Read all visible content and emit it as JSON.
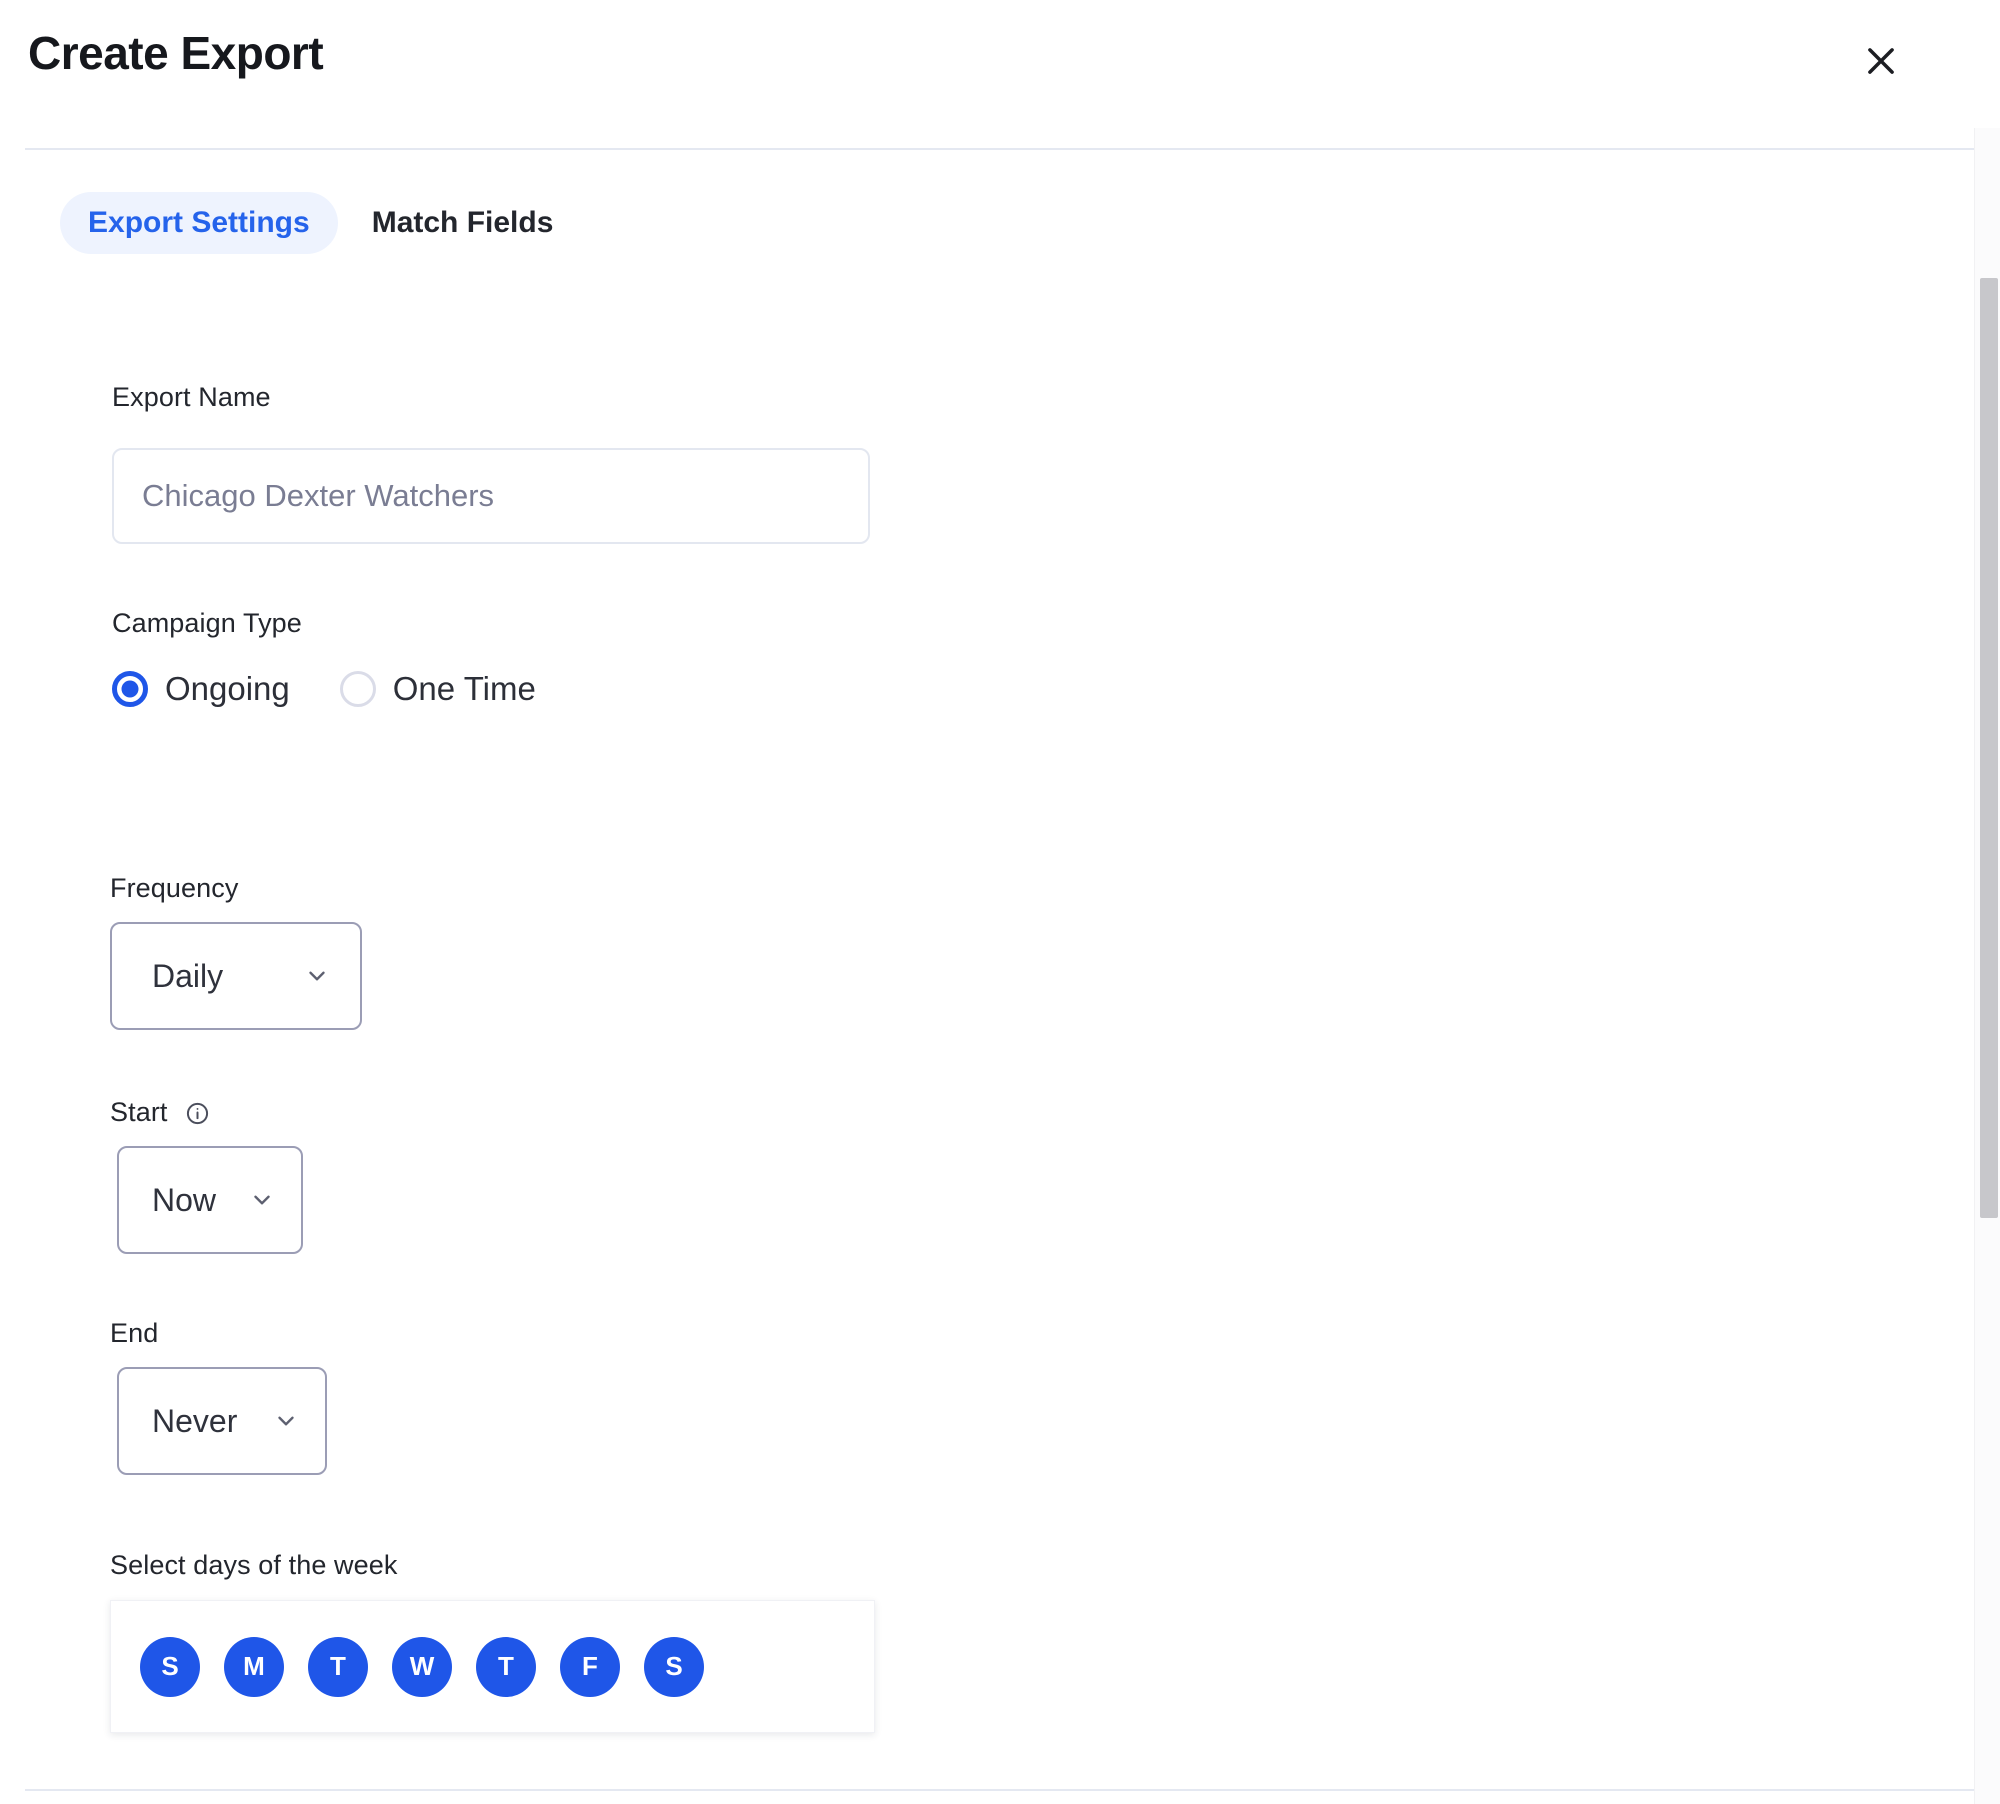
{
  "modal": {
    "title": "Create Export",
    "close_icon": "close-icon"
  },
  "tabs": [
    {
      "label": "Export Settings",
      "active": true
    },
    {
      "label": "Match Fields",
      "active": false
    }
  ],
  "form": {
    "export_name": {
      "label": "Export Name",
      "value": "",
      "placeholder": "Chicago Dexter Watchers"
    },
    "campaign_type": {
      "label": "Campaign Type",
      "options": [
        {
          "label": "Ongoing",
          "selected": true
        },
        {
          "label": "One Time",
          "selected": false
        }
      ]
    },
    "frequency": {
      "label": "Frequency",
      "value": "Daily"
    },
    "start": {
      "label": "Start",
      "info_icon": "info-icon",
      "value": "Now"
    },
    "end": {
      "label": "End",
      "value": "Never"
    },
    "days_of_week": {
      "label": "Select days of the week",
      "days": [
        {
          "letter": "S",
          "name": "sunday",
          "selected": true
        },
        {
          "letter": "M",
          "name": "monday",
          "selected": true
        },
        {
          "letter": "T",
          "name": "tuesday",
          "selected": true
        },
        {
          "letter": "W",
          "name": "wednesday",
          "selected": true
        },
        {
          "letter": "T",
          "name": "thursday",
          "selected": true
        },
        {
          "letter": "F",
          "name": "friday",
          "selected": true
        },
        {
          "letter": "S",
          "name": "saturday",
          "selected": true
        }
      ]
    }
  },
  "colors": {
    "accent_blue": "#1f56e8",
    "tab_active_text": "#2563eb",
    "tab_active_bg": "#eef3fe",
    "border_light": "#e3e7f0",
    "border_select": "#9b9db5",
    "text_primary": "#23262d",
    "placeholder": "#7a7d93"
  }
}
